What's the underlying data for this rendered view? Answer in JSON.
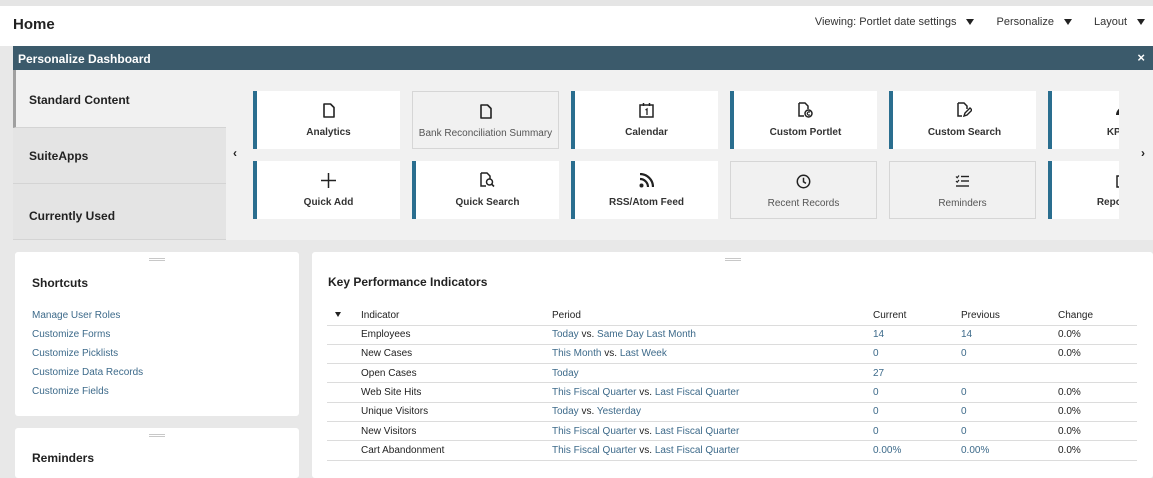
{
  "header": {
    "title": "Home",
    "viewing_label": "Viewing: Portlet date settings",
    "personalize_label": "Personalize",
    "layout_label": "Layout"
  },
  "personalize": {
    "title": "Personalize Dashboard",
    "close_glyph": "×",
    "tabs": [
      {
        "label": "Standard Content"
      },
      {
        "label": "SuiteApps"
      },
      {
        "label": "Currently Used"
      }
    ],
    "prev_glyph": "‹",
    "next_glyph": "›",
    "tiles": [
      {
        "label": "Analytics",
        "icon": "document-icon",
        "enabled": true
      },
      {
        "label": "Bank Reconciliation Summary",
        "icon": "document-icon",
        "enabled": false
      },
      {
        "label": "Calendar",
        "icon": "calendar-icon",
        "enabled": true
      },
      {
        "label": "Custom Portlet",
        "icon": "custom-portlet-icon",
        "enabled": true
      },
      {
        "label": "Custom Search",
        "icon": "custom-search-icon",
        "enabled": true
      },
      {
        "label": "KPI Me",
        "icon": "gauge-icon",
        "enabled": true
      },
      {
        "label": "Quick Add",
        "icon": "plus-icon",
        "enabled": true
      },
      {
        "label": "Quick Search",
        "icon": "quick-search-icon",
        "enabled": true
      },
      {
        "label": "RSS/Atom Feed",
        "icon": "rss-icon",
        "enabled": true
      },
      {
        "label": "Recent Records",
        "icon": "clock-icon",
        "enabled": false
      },
      {
        "label": "Reminders",
        "icon": "checklist-icon",
        "enabled": false
      },
      {
        "label": "Report Sna",
        "icon": "report-icon",
        "enabled": true
      }
    ]
  },
  "shortcuts": {
    "title": "Shortcuts",
    "items": [
      "Manage User Roles",
      "Customize Forms",
      "Customize Picklists",
      "Customize Data Records",
      "Customize Fields"
    ]
  },
  "reminders": {
    "title": "Reminders"
  },
  "kpi": {
    "title": "Key Performance Indicators",
    "columns": {
      "indicator": "Indicator",
      "period": "Period",
      "current": "Current",
      "previous": "Previous",
      "change": "Change"
    },
    "rows": [
      {
        "indicator": "Employees",
        "period_a": "Today",
        "period_b": "Same Day Last Month",
        "current": "14",
        "previous": "14",
        "change": "0.0%"
      },
      {
        "indicator": "New Cases",
        "period_a": "This Month",
        "period_b": "Last Week",
        "current": "0",
        "previous": "0",
        "change": "0.0%"
      },
      {
        "indicator": "Open Cases",
        "period_a": "Today",
        "period_b": "",
        "current": "27",
        "previous": "",
        "change": ""
      },
      {
        "indicator": "Web Site Hits",
        "period_a": "This Fiscal Quarter",
        "period_b": "Last Fiscal Quarter",
        "current": "0",
        "previous": "0",
        "change": "0.0%"
      },
      {
        "indicator": "Unique Visitors",
        "period_a": "Today",
        "period_b": "Yesterday",
        "current": "0",
        "previous": "0",
        "change": "0.0%"
      },
      {
        "indicator": "New Visitors",
        "period_a": "This Fiscal Quarter",
        "period_b": "Last Fiscal Quarter",
        "current": "0",
        "previous": "0",
        "change": "0.0%"
      },
      {
        "indicator": "Cart Abandonment",
        "period_a": "This Fiscal Quarter",
        "period_b": "Last Fiscal Quarter",
        "current": "0.00%",
        "previous": "0.00%",
        "change": "0.0%"
      }
    ],
    "vs_text": " vs. "
  }
}
